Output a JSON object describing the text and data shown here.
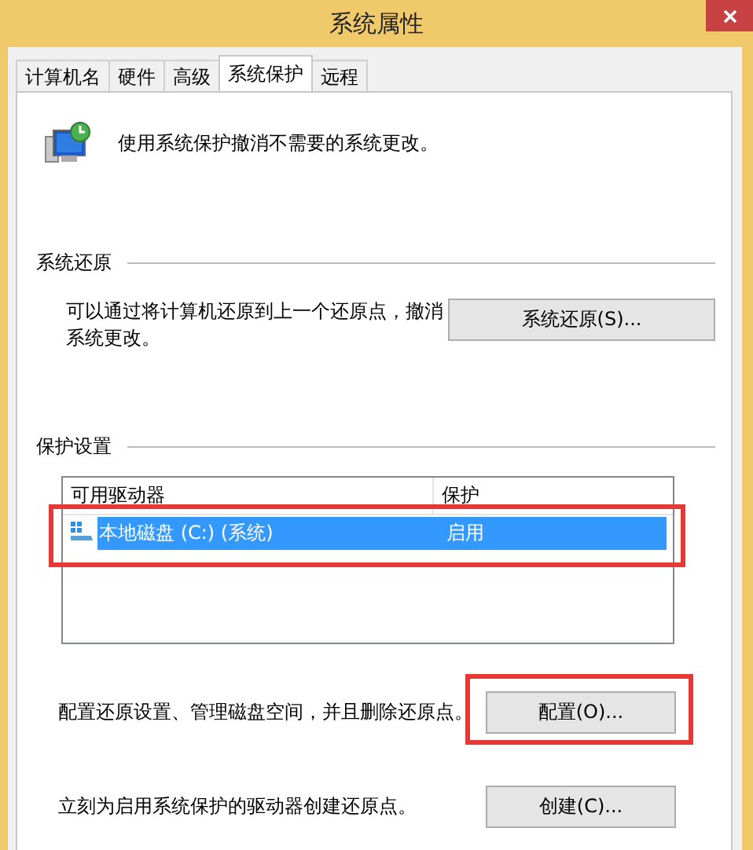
{
  "window": {
    "title": "系统属性"
  },
  "tabs": [
    {
      "label": "计算机名",
      "selected": false
    },
    {
      "label": "硬件",
      "selected": false
    },
    {
      "label": "高级",
      "selected": false
    },
    {
      "label": "系统保护",
      "selected": true
    },
    {
      "label": "远程",
      "selected": false
    }
  ],
  "intro": "使用系统保护撤消不需要的系统更改。",
  "restore": {
    "title": "系统还原",
    "description": "可以通过将计算机还原到上一个还原点，撤消系统更改。",
    "button": "系统还原(S)...",
    "highlighted": false
  },
  "protection": {
    "title": "保护设置",
    "columns": [
      "可用驱动器",
      "保护"
    ],
    "drives": [
      {
        "name": "本地磁盘 (C:) (系统)",
        "protection": "启用",
        "selected": true,
        "highlighted": true
      }
    ],
    "configure": {
      "description": "配置还原设置、管理磁盘空间，并且删除还原点。",
      "button": "配置(O)...",
      "highlighted": true
    },
    "create": {
      "description": "立刻为启用系统保护的驱动器创建还原点。",
      "button": "创建(C)...",
      "highlighted": false
    }
  }
}
